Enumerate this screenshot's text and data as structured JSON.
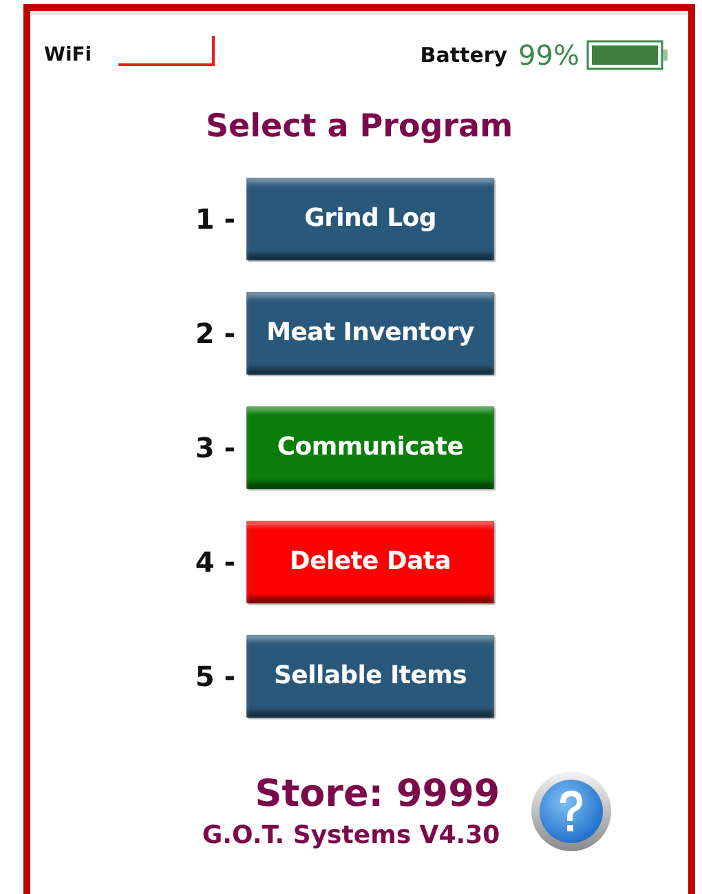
{
  "status_bar": {
    "wifi_label": "WiFi",
    "battery_label": "Battery",
    "battery_percent": "99%"
  },
  "title": "Select a Program",
  "programs": [
    {
      "number": "1 -",
      "label": "Grind Log",
      "color": "#2a587a"
    },
    {
      "number": "2 -",
      "label": "Meat Inventory",
      "color": "#2a587a"
    },
    {
      "number": "3 -",
      "label": "Communicate",
      "color": "#0a7d0a"
    },
    {
      "number": "4 -",
      "label": "Delete Data",
      "color": "#ff0000"
    },
    {
      "number": "5 -",
      "label": "Sellable Items",
      "color": "#2a587a"
    }
  ],
  "footer": {
    "store": "Store: 9999",
    "version": "G.O.T. Systems V4.30"
  }
}
